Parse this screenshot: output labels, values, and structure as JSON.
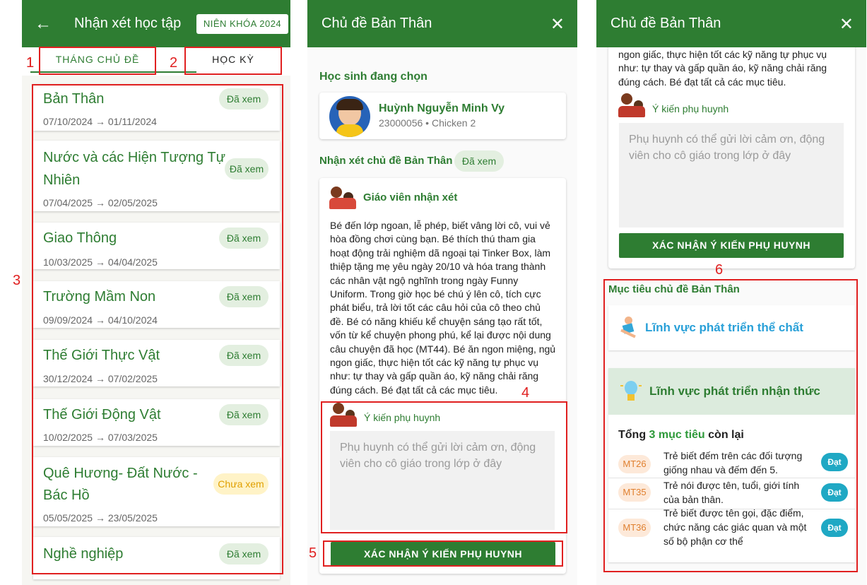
{
  "panel1": {
    "title": "Nhận xét học tập",
    "year_button": "NIÊN KHÓA 2024",
    "tab_month": "THÁNG CHỦ ĐỀ",
    "tab_semester": "HỌC KỲ",
    "topics": [
      {
        "name_lines": [
          "Bản Thân"
        ],
        "date_from": "07/10/2024",
        "date_to": "01/11/2024",
        "status": "Đã xem"
      },
      {
        "name_lines": [
          "Nước và các Hiện Tượng Tự",
          "Nhiên"
        ],
        "date_from": "07/04/2025",
        "date_to": "02/05/2025",
        "status": "Đã xem"
      },
      {
        "name_lines": [
          "Giao Thông"
        ],
        "date_from": "10/03/2025",
        "date_to": "04/04/2025",
        "status": "Đã xem"
      },
      {
        "name_lines": [
          "Trường Mầm Non"
        ],
        "date_from": "09/09/2024",
        "date_to": "04/10/2024",
        "status": "Đã xem"
      },
      {
        "name_lines": [
          "Thế Giới Thực Vật"
        ],
        "date_from": "30/12/2024",
        "date_to": "07/02/2025",
        "status": "Đã xem"
      },
      {
        "name_lines": [
          "Thế Giới Động Vật"
        ],
        "date_from": "10/02/2025",
        "date_to": "07/03/2025",
        "status": "Đã xem"
      },
      {
        "name_lines": [
          "Quê Hương- Đất Nước -",
          "Bác Hồ"
        ],
        "date_from": "05/05/2025",
        "date_to": "23/05/2025",
        "status": "Chưa xem"
      },
      {
        "name_lines": [
          "Nghề nghiệp"
        ],
        "date_from": "",
        "date_to": "",
        "status": "Đã xem"
      }
    ],
    "callouts": [
      "1",
      "2",
      "3"
    ]
  },
  "panel2": {
    "title": "Chủ đề Bản Thân",
    "close_icon": "close-icon",
    "selected_student_label": "Học sinh đang chọn",
    "student_name": "Huỳnh Nguyễn Minh Vy",
    "student_meta": "23000056 • Chicken 2",
    "review_label": "Nhận xét chủ đề Bản Thân",
    "review_status": "Đã xem",
    "teacher_label": "Giáo viên nhận xét",
    "teacher_comment_lines": [
      "Bé đến lớp ngoan, lễ phép, biết vâng lời cô, vui vẻ",
      "hòa đồng chơi cùng bạn. Bé thích thú tham gia",
      "hoạt động trải nghiệm dã ngoại tại Tinker Box, làm",
      "thiệp tặng mẹ yêu ngày 20/10 và hóa trang thành",
      "các nhân vật ngộ nghĩnh trong ngày Funny",
      "Uniform. Trong giờ học bé chú ý lên cô, tích cực",
      "phát biểu, trả lời tốt các câu hỏi của cô theo chủ",
      "đề. Bé có năng khiếu kể chuyện sáng tạo rất tốt,",
      "vốn từ kể chuyện phong phú, kể lại được nội dung",
      "câu chuyện đã học (MT44). Bé ăn ngon miệng, ngủ",
      "ngon giấc, thực hiện tốt các kỹ năng tự phục vụ",
      "như: tự thay và gấp quần áo, kỹ năng chải răng",
      "đúng cách. Bé đạt tất cả các mục tiêu."
    ],
    "parent_label": "Ý kiến phụ huynh",
    "parent_placeholder": "Phụ huynh có thể gửi lời cảm ơn, động viên cho cô giáo trong lớp ở đây",
    "confirm_button": "XÁC NHẬN Ý KIẾN PHỤ HUYNH",
    "callouts": [
      "4",
      "5"
    ]
  },
  "panel3": {
    "title": "Chủ đề Bản Thân",
    "comment_tail_lines": [
      "ngon giấc, thực hiện tốt các kỹ năng tự phục vụ",
      "như: tự thay và gấp quần áo, kỹ năng chải răng",
      "đúng cách. Bé đạt tất cả các mục tiêu."
    ],
    "parent_label": "Ý kiến phụ huynh",
    "parent_placeholder": "Phụ huynh có thể gửi lời cảm ơn, động viên cho cô giáo trong lớp ở đây",
    "confirm_button": "XÁC NHẬN Ý KIẾN PHỤ HUYNH",
    "goals_label": "Mục tiêu chủ đề Bản Thân",
    "domain_physical": "Lĩnh vực phát triển thể chất",
    "domain_cognitive": "Lĩnh vực phát triển nhận thức",
    "total_prefix": "Tổng",
    "total_count": "3 mục tiêu",
    "total_suffix": "còn lại",
    "goals": [
      {
        "code": "MT26",
        "text": "Trẻ biết đếm trên các đối tượng giống nhau và đếm đến 5.",
        "status": "Đạt"
      },
      {
        "code": "MT35",
        "text": "Trẻ nói được tên, tuổi, giới tính của bản thân.",
        "status": "Đạt"
      },
      {
        "code": "MT36",
        "text": "Trẻ biết được tên gọi, đặc điểm, chức năng các giác quan và một số bộ phận cơ thể",
        "status": "Đạt"
      }
    ],
    "callouts": [
      "6"
    ]
  },
  "colors": {
    "primary": "#2e7d32",
    "callout": "#e02020",
    "seen_bg": "#e3efe0",
    "unseen_bg": "#fff3c7",
    "accent_blue": "#1fa8c4"
  }
}
